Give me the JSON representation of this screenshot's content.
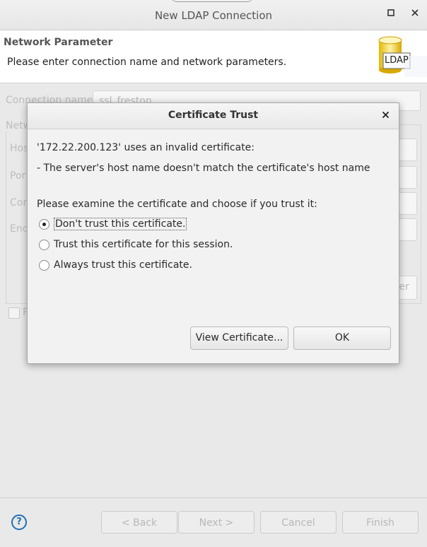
{
  "window": {
    "title": "New LDAP Connection",
    "maximize_icon": "maximize-icon",
    "close_icon": "close-icon"
  },
  "banner": {
    "title": "Network Parameter",
    "description": "Please enter connection name and network parameters.",
    "icon_text": "LDAP"
  },
  "background_form": {
    "connection_name_label": "Connection name:",
    "connection_name_value": "ssl_freston",
    "partial_labels": [
      "Netw",
      "Hos",
      "Por",
      "Con",
      "Enc"
    ],
    "partial_button": "ter",
    "checkbox_partial": "R"
  },
  "dialog": {
    "title": "Certificate Trust",
    "message_line1": "'172.22.200.123' uses an invalid certificate:",
    "message_line2": "- The server's host name doesn't match the certificate's host name",
    "prompt": "Please examine the certificate and choose if you trust it:",
    "options": [
      {
        "label": "Don't trust this certificate.",
        "selected": true
      },
      {
        "label": "Trust this certificate for this session.",
        "selected": false
      },
      {
        "label": "Always trust this certificate.",
        "selected": false
      }
    ],
    "view_certificate_button": "View Certificate...",
    "ok_button": "OK"
  },
  "footer": {
    "back": "< Back",
    "next": "Next >",
    "cancel": "Cancel",
    "finish": "Finish",
    "help": "?"
  }
}
